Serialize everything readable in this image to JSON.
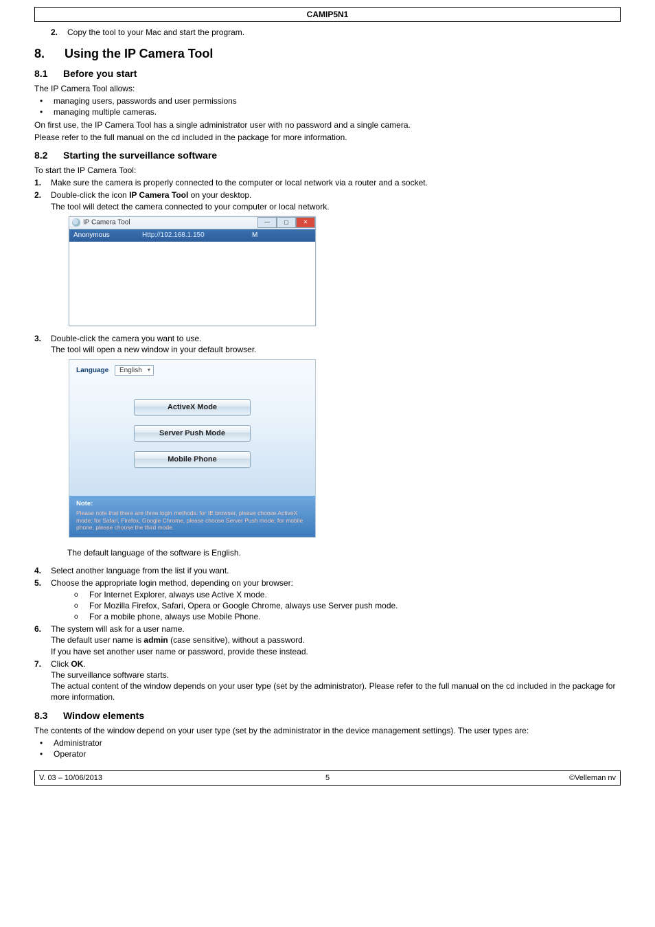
{
  "header": {
    "title": "CAMIP5N1"
  },
  "pre_step": {
    "num": "2.",
    "text": "Copy the tool to your Mac and start the program."
  },
  "sec8": {
    "num": "8.",
    "title": "Using the IP Camera Tool"
  },
  "sec81": {
    "num": "8.1",
    "title": "Before you start",
    "intro": "The IP Camera Tool allows:",
    "bullets": [
      "managing users, passwords and user permissions",
      "managing multiple cameras."
    ],
    "p1": "On first use, the IP Camera Tool has a single administrator user with no password and a single camera.",
    "p2": "Please refer to the full manual on the cd included in the package for more information."
  },
  "sec82": {
    "num": "8.2",
    "title": "Starting the surveillance software",
    "intro": "To start the IP Camera Tool:",
    "step1_num": "1.",
    "step1": "Make sure the camera is properly connected to the computer or local network via a router and a socket.",
    "step2_num": "2.",
    "step2_a": "Double-click the icon ",
    "step2_bold": "IP Camera Tool",
    "step2_b": " on your desktop.",
    "step2_note": "The tool will detect the camera connected to your computer or local network.",
    "tool": {
      "title": "IP Camera Tool",
      "row": {
        "name": "Anonymous",
        "url": "Http://192.168.1.150",
        "flag": "M"
      }
    },
    "step3_num": "3.",
    "step3_a": "Double-click the camera you want to use.",
    "step3_b": "The tool will open a new window in your default browser.",
    "login": {
      "lang_label": "Language",
      "lang_value": "English",
      "btn_activex": "ActiveX Mode",
      "btn_serverpush": "Server Push Mode",
      "btn_mobile": "Mobile Phone",
      "note_title": "Note:",
      "note_body": "Please note that there are three login methods: for IE browser, please choose ActiveX mode; for Safari, Firefox, Google Chrome, please choose Server Push mode; for mobile phone, please choose the third mode."
    },
    "after_login": "The default language of the software is English.",
    "step4_num": "4.",
    "step4": "Select another language from the list if you want.",
    "step5_num": "5.",
    "step5": "Choose the appropriate login method, depending on your browser:",
    "step5_subs": [
      "For Internet Explorer, always use Active X mode.",
      "For Mozilla Firefox, Safari, Opera or Google Chrome, always use Server push mode.",
      "For a mobile phone, always use Mobile Phone."
    ],
    "step6_num": "6.",
    "step6_a": "The system will ask for a user name.",
    "step6_b_pre": "The default user name is ",
    "step6_b_bold": "admin",
    "step6_b_post": " (case sensitive), without a password.",
    "step6_c": "If you have set another user name or password, provide these instead.",
    "step7_num": "7.",
    "step7_a_pre": "Click ",
    "step7_a_bold": "OK",
    "step7_a_post": ".",
    "step7_b": "The surveillance software starts.",
    "step7_c": "The actual content of the window depends on your user type (set by the administrator). Please refer to the full manual on the cd included in the package for more information."
  },
  "sec83": {
    "num": "8.3",
    "title": "Window elements",
    "p1": "The contents of the window depend on your user type (set by the administrator in the device management settings). The user types are:",
    "bullets": [
      "Administrator",
      "Operator"
    ]
  },
  "footer": {
    "left": "V. 03 – 10/06/2013",
    "center": "5",
    "right": "©Velleman nv"
  }
}
